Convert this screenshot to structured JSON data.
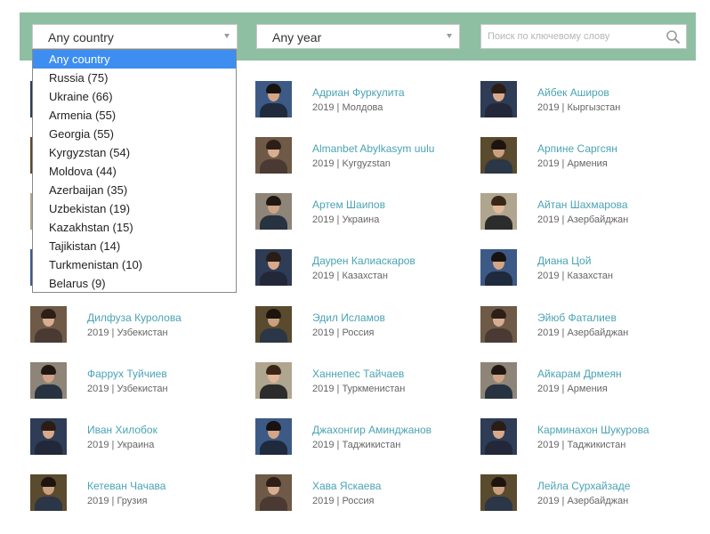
{
  "filters": {
    "country_value": "Any country",
    "year_value": "Any year",
    "search_placeholder": "Поиск по ключевому слову"
  },
  "country_dropdown": {
    "options": [
      "Any country",
      "Russia (75)",
      "Ukraine (66)",
      "Armenia (55)",
      "Georgia (55)",
      "Kyrgyzstan (54)",
      "Moldova (44)",
      "Azerbaijan (35)",
      "Uzbekistan (19)",
      "Kazakhstan (15)",
      "Tajikistan (14)",
      "Turkmenistan (10)",
      "Belarus (9)"
    ],
    "selected_index": 0
  },
  "people": [
    [
      {
        "name": "",
        "meta": ""
      },
      {
        "name": "",
        "meta": ""
      },
      {
        "name": "",
        "meta": ""
      },
      {
        "name": "",
        "meta": ""
      },
      {
        "name": "Дилфуза Куролова",
        "meta": "2019 | Узбекистан"
      },
      {
        "name": "Фаррух Туйчиев",
        "meta": "2019 | Узбекистан"
      },
      {
        "name": "Иван Хилобок",
        "meta": "2019 | Украина"
      },
      {
        "name": "Кетеван Чачава",
        "meta": "2019 | Грузия"
      }
    ],
    [
      {
        "name": "Адриан Фуркулита",
        "meta": "2019 | Молдова"
      },
      {
        "name": "Almanbet Abylkasym uulu",
        "meta": "2019 | Kyrgyzstan"
      },
      {
        "name": "Артем Шаипов",
        "meta": "2019 | Украина"
      },
      {
        "name": "Даурен Калиаскаров",
        "meta": "2019 | Казахстан"
      },
      {
        "name": "Эдил Исламов",
        "meta": "2019 | Россия"
      },
      {
        "name": "Ханнепес Тайчаев",
        "meta": "2019 | Туркменистан"
      },
      {
        "name": "Джахонгир Аминджанов",
        "meta": "2019 | Таджикистан"
      },
      {
        "name": "Хава Яскаева",
        "meta": "2019 | Россия"
      }
    ],
    [
      {
        "name": "Айбек Аширов",
        "meta": "2019 | Кыргызстан"
      },
      {
        "name": "Арпине Саргсян",
        "meta": "2019 | Армения"
      },
      {
        "name": "Айтан Шахмарова",
        "meta": "2019 | Азербайджан"
      },
      {
        "name": "Диана Цой",
        "meta": "2019 | Казахстан"
      },
      {
        "name": "Эйюб Фаталиев",
        "meta": "2019 | Азербайджан"
      },
      {
        "name": "Айкарам Дрмеян",
        "meta": "2019 | Армения"
      },
      {
        "name": "Карминахон Шукурова",
        "meta": "2019 | Таджикистан"
      },
      {
        "name": "Лейла Сурхайзаде",
        "meta": "2019 | Азербайджан"
      }
    ]
  ],
  "colors": {
    "filter_bar": "#8fbfa2",
    "name_link": "#4aa3b4",
    "dropdown_highlight": "#3d8ef0"
  }
}
